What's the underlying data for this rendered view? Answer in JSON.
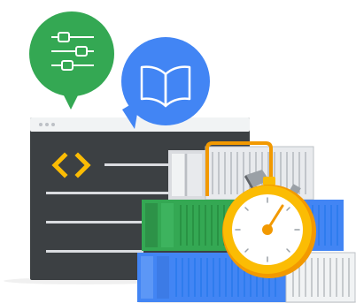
{
  "illustration": {
    "bubbles": [
      {
        "icon": "sliders-icon",
        "color": "#34A853"
      },
      {
        "icon": "open-book-icon",
        "color": "#4285F4"
      }
    ],
    "window": {
      "icon": "code-brackets-icon",
      "frame_color": "#3C4043",
      "titlebar_color": "#F1F3F4",
      "accent_color": "#FBBC04",
      "line_color": "#DADCE0"
    },
    "containers": {
      "colors": {
        "gray": "#E8EAED",
        "green": "#34A853",
        "blue": "#4285F4",
        "orange": "#F29900"
      }
    },
    "stopwatch": {
      "icon": "stopwatch-icon",
      "ring_color": "#FBBC04",
      "face_color": "#FFFFFF",
      "hand_color": "#F29900"
    }
  }
}
